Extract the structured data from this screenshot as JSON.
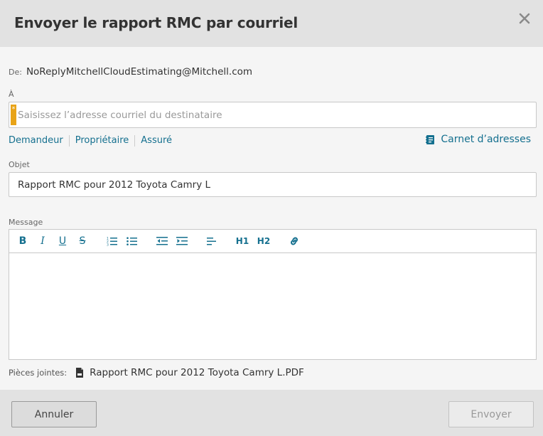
{
  "dialog": {
    "title": "Envoyer le rapport RMC par courriel",
    "close_icon": "close-icon"
  },
  "from": {
    "label": "De:",
    "value": "NoReplyMitchellCloudEstimating@Mitchell.com"
  },
  "to": {
    "label": "À",
    "required_marker": "*",
    "placeholder": "Saisissez l’adresse courriel du destinataire",
    "value": "",
    "quick_links": [
      "Demandeur",
      "Propriétaire",
      "Assuré"
    ],
    "address_book_label": "Carnet d’adresses",
    "address_book_icon": "address-book-icon"
  },
  "subject": {
    "label": "Objet",
    "value": "Rapport RMC pour 2012 Toyota Camry L"
  },
  "message": {
    "label": "Message",
    "toolbar": [
      {
        "name": "bold-button",
        "glyph": "B",
        "icon": "bold-icon"
      },
      {
        "name": "italic-button",
        "glyph": "I",
        "icon": "italic-icon"
      },
      {
        "name": "underline-button",
        "glyph": "U",
        "icon": "underline-icon"
      },
      {
        "name": "strikethrough-button",
        "glyph": "S",
        "icon": "strikethrough-icon"
      },
      {
        "name": "ordered-list-button",
        "icon": "ordered-list-icon"
      },
      {
        "name": "bullet-list-button",
        "icon": "bullet-list-icon"
      },
      {
        "name": "outdent-button",
        "icon": "outdent-icon"
      },
      {
        "name": "indent-button",
        "icon": "indent-icon"
      },
      {
        "name": "align-button",
        "icon": "align-left-icon"
      },
      {
        "name": "heading1-button",
        "glyph": "H1",
        "icon": "heading1-icon"
      },
      {
        "name": "heading2-button",
        "glyph": "H2",
        "icon": "heading2-icon"
      },
      {
        "name": "link-button",
        "icon": "link-icon"
      }
    ],
    "body": ""
  },
  "attachments": {
    "label": "Pièces jointes:",
    "file_icon": "pdf-file-icon",
    "file_name": "Rapport RMC pour 2012 Toyota Camry L.PDF"
  },
  "footer": {
    "cancel_label": "Annuler",
    "send_label": "Envoyer"
  },
  "colors": {
    "accent": "#15708f",
    "required": "#e8a317",
    "header_bg": "#e2e2e2",
    "body_bg": "#f5f5f5"
  }
}
